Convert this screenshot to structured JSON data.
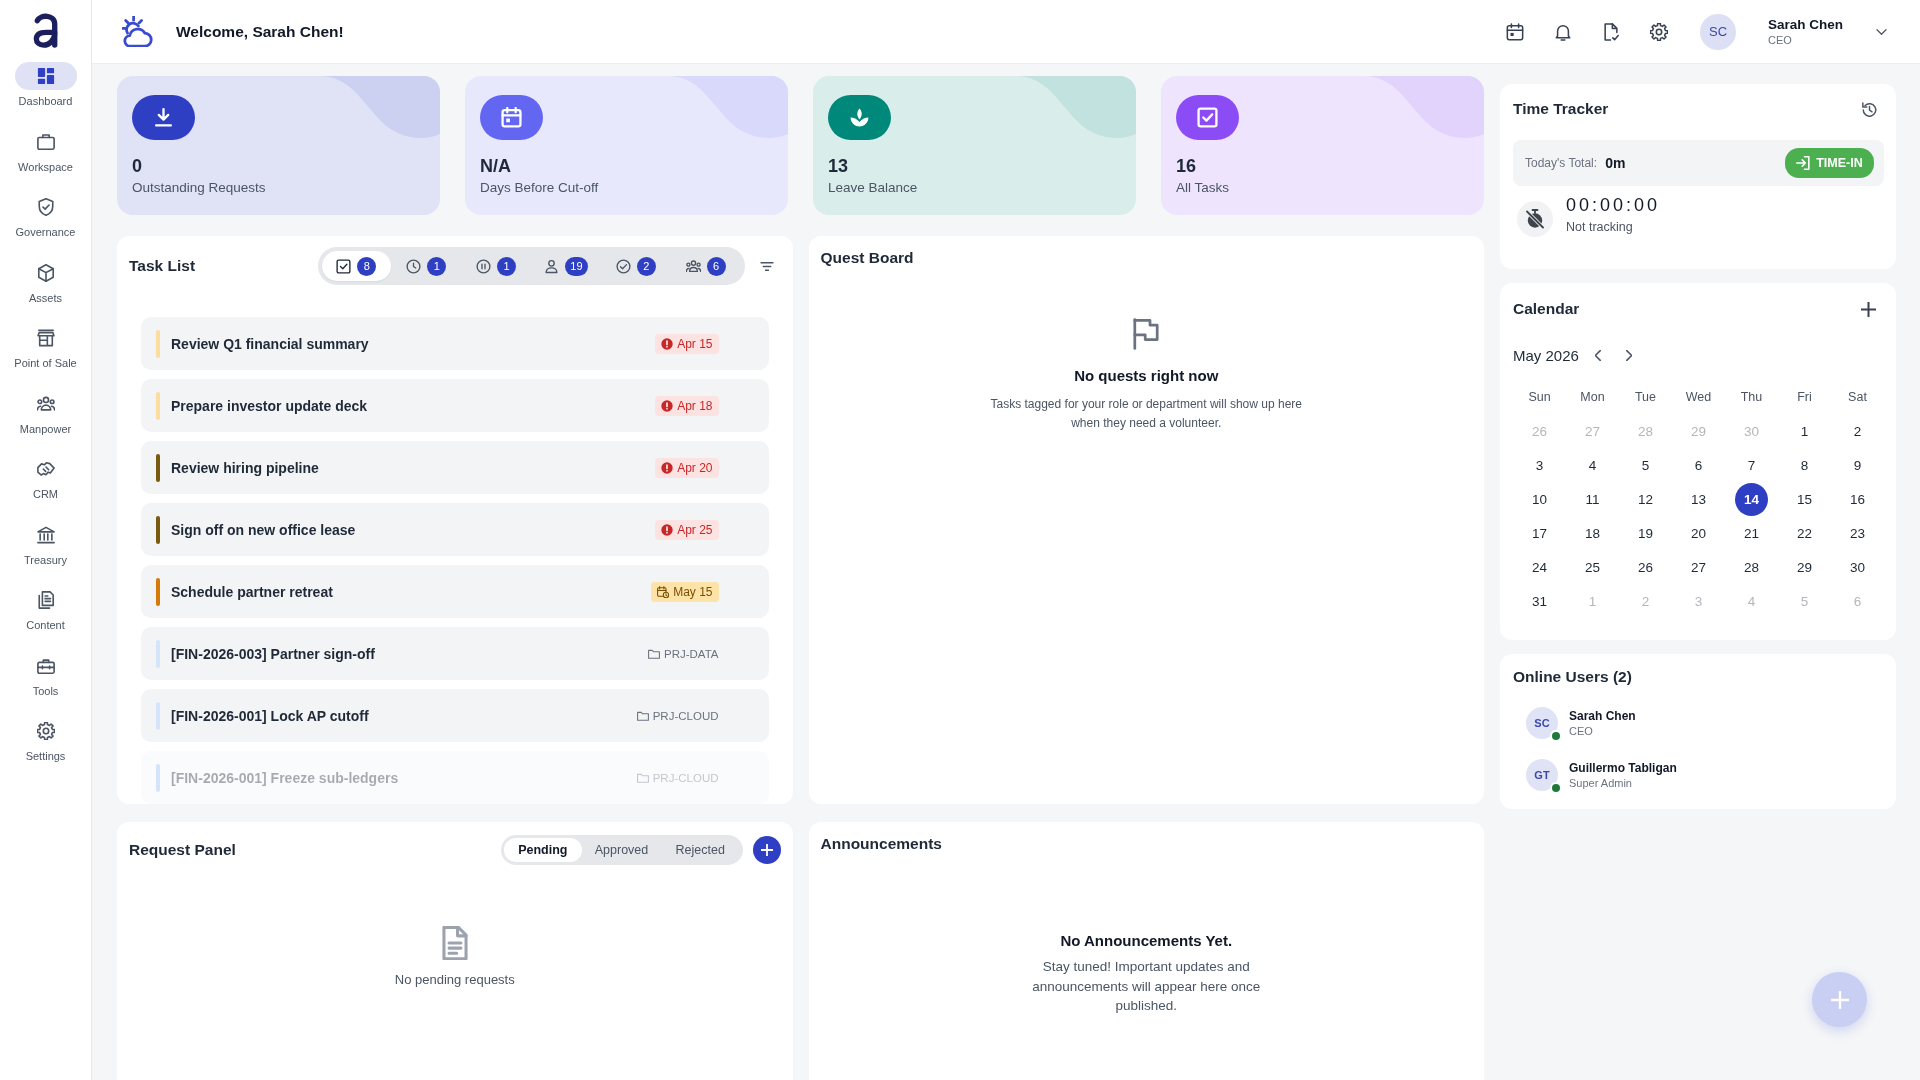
{
  "sidebar": {
    "items": [
      {
        "label": "Dashboard",
        "selected": true
      },
      {
        "label": "Workspace",
        "selected": false
      },
      {
        "label": "Governance",
        "selected": false
      },
      {
        "label": "Assets",
        "selected": false
      },
      {
        "label": "Point of Sale",
        "selected": false
      },
      {
        "label": "Manpower",
        "selected": false
      },
      {
        "label": "CRM",
        "selected": false
      },
      {
        "label": "Treasury",
        "selected": false
      },
      {
        "label": "Content",
        "selected": false
      },
      {
        "label": "Tools",
        "selected": false
      },
      {
        "label": "Settings",
        "selected": false
      }
    ]
  },
  "header": {
    "greeting": "Welcome, Sarah Chen!",
    "user": {
      "initials": "SC",
      "name": "Sarah Chen",
      "role": "CEO"
    }
  },
  "stats": [
    {
      "value": "0",
      "label": "Outstanding Requests",
      "color": "#2f3fc4"
    },
    {
      "value": "N/A",
      "label": "Days Before Cut-off",
      "color": "#6366f1"
    },
    {
      "value": "13",
      "label": "Leave Balance",
      "color": "#00897b"
    },
    {
      "value": "16",
      "label": "All Tasks",
      "color": "#8b4cf6"
    }
  ],
  "task_list": {
    "title": "Task List",
    "filters": [
      {
        "count": "8",
        "selected": true
      },
      {
        "count": "1",
        "selected": false
      },
      {
        "count": "1",
        "selected": false
      },
      {
        "count": "19",
        "selected": false
      },
      {
        "count": "2",
        "selected": false
      },
      {
        "count": "6",
        "selected": false
      }
    ],
    "tasks": [
      {
        "title": "Review Q1 financial summary",
        "color": "#fddca0",
        "faded": false,
        "tag": {
          "kind": "overdue",
          "text": "Apr 15"
        }
      },
      {
        "title": "Prepare investor update deck",
        "color": "#fddca0",
        "faded": false,
        "tag": {
          "kind": "overdue",
          "text": "Apr 18"
        }
      },
      {
        "title": "Review hiring pipeline",
        "color": "#7b5a10",
        "faded": false,
        "tag": {
          "kind": "overdue",
          "text": "Apr 20"
        }
      },
      {
        "title": "Sign off on new office lease",
        "color": "#7b5a10",
        "faded": false,
        "tag": {
          "kind": "overdue",
          "text": "Apr 25"
        }
      },
      {
        "title": "Schedule partner retreat",
        "color": "#d67a07",
        "faded": false,
        "tag": {
          "kind": "upcoming",
          "text": "May 15"
        }
      },
      {
        "title": "[FIN-2026-003] Partner sign-off",
        "color": "#d4e4fb",
        "faded": false,
        "tag": {
          "kind": "project",
          "text": "PRJ-DATA"
        }
      },
      {
        "title": "[FIN-2026-001] Lock AP cutoff",
        "color": "#d4e4fb",
        "faded": false,
        "tag": {
          "kind": "project",
          "text": "PRJ-CLOUD"
        }
      },
      {
        "title": "[FIN-2026-001] Freeze sub-ledgers",
        "color": "#d4e4fb",
        "faded": true,
        "tag": {
          "kind": "project",
          "text": "PRJ-CLOUD"
        }
      }
    ]
  },
  "quest_board": {
    "title": "Quest Board",
    "empty_title": "No quests right now",
    "empty_text": "Tasks tagged for your role or department will show up here when they need a volunteer."
  },
  "request_panel": {
    "title": "Request Panel",
    "tabs": [
      {
        "label": "Pending",
        "selected": true
      },
      {
        "label": "Approved",
        "selected": false
      },
      {
        "label": "Rejected",
        "selected": false
      }
    ],
    "empty_text": "No pending requests"
  },
  "announcements": {
    "title": "Announcements",
    "empty_title": "No Announcements Yet.",
    "empty_text": "Stay tuned! Important updates and announcements will appear here once published."
  },
  "time_tracker": {
    "title": "Time Tracker",
    "total_label": "Today's Total:",
    "total_value": "0m",
    "button": "TIME-IN",
    "timer": "00:00:00",
    "status": "Not tracking"
  },
  "calendar": {
    "title": "Calendar",
    "month": "May 2026",
    "weekdays": [
      "Sun",
      "Mon",
      "Tue",
      "Wed",
      "Thu",
      "Fri",
      "Sat"
    ],
    "weeks": [
      [
        {
          "day": "26",
          "outside_month": true,
          "selected": false
        },
        {
          "day": "27",
          "outside_month": true,
          "selected": false
        },
        {
          "day": "28",
          "outside_month": true,
          "selected": false
        },
        {
          "day": "29",
          "outside_month": true,
          "selected": false
        },
        {
          "day": "30",
          "outside_month": true,
          "selected": false
        },
        {
          "day": "1",
          "outside_month": false,
          "selected": false
        },
        {
          "day": "2",
          "outside_month": false,
          "selected": false
        }
      ],
      [
        {
          "day": "3",
          "outside_month": false,
          "selected": false
        },
        {
          "day": "4",
          "outside_month": false,
          "selected": false
        },
        {
          "day": "5",
          "outside_month": false,
          "selected": false
        },
        {
          "day": "6",
          "outside_month": false,
          "selected": false
        },
        {
          "day": "7",
          "outside_month": false,
          "selected": false
        },
        {
          "day": "8",
          "outside_month": false,
          "selected": false
        },
        {
          "day": "9",
          "outside_month": false,
          "selected": false
        }
      ],
      [
        {
          "day": "10",
          "outside_month": false,
          "selected": false
        },
        {
          "day": "11",
          "outside_month": false,
          "selected": false
        },
        {
          "day": "12",
          "outside_month": false,
          "selected": false
        },
        {
          "day": "13",
          "outside_month": false,
          "selected": false
        },
        {
          "day": "14",
          "outside_month": false,
          "selected": true
        },
        {
          "day": "15",
          "outside_month": false,
          "selected": false
        },
        {
          "day": "16",
          "outside_month": false,
          "selected": false
        }
      ],
      [
        {
          "day": "17",
          "outside_month": false,
          "selected": false
        },
        {
          "day": "18",
          "outside_month": false,
          "selected": false
        },
        {
          "day": "19",
          "outside_month": false,
          "selected": false
        },
        {
          "day": "20",
          "outside_month": false,
          "selected": false
        },
        {
          "day": "21",
          "outside_month": false,
          "selected": false
        },
        {
          "day": "22",
          "outside_month": false,
          "selected": false
        },
        {
          "day": "23",
          "outside_month": false,
          "selected": false
        }
      ],
      [
        {
          "day": "24",
          "outside_month": false,
          "selected": false
        },
        {
          "day": "25",
          "outside_month": false,
          "selected": false
        },
        {
          "day": "26",
          "outside_month": false,
          "selected": false
        },
        {
          "day": "27",
          "outside_month": false,
          "selected": false
        },
        {
          "day": "28",
          "outside_month": false,
          "selected": false
        },
        {
          "day": "29",
          "outside_month": false,
          "selected": false
        },
        {
          "day": "30",
          "outside_month": false,
          "selected": false
        }
      ],
      [
        {
          "day": "31",
          "outside_month": false,
          "selected": false
        },
        {
          "day": "1",
          "outside_month": true,
          "selected": false
        },
        {
          "day": "2",
          "outside_month": true,
          "selected": false
        },
        {
          "day": "3",
          "outside_month": true,
          "selected": false
        },
        {
          "day": "4",
          "outside_month": true,
          "selected": false
        },
        {
          "day": "5",
          "outside_month": true,
          "selected": false
        },
        {
          "day": "6",
          "outside_month": true,
          "selected": false
        }
      ]
    ]
  },
  "online_users": {
    "title": "Online Users (2)",
    "users": [
      {
        "initials": "SC",
        "name": "Sarah Chen",
        "role": "CEO",
        "online": true
      },
      {
        "initials": "GT",
        "name": "Guillermo Tabligan",
        "role": "Super Admin",
        "online": true
      }
    ]
  }
}
